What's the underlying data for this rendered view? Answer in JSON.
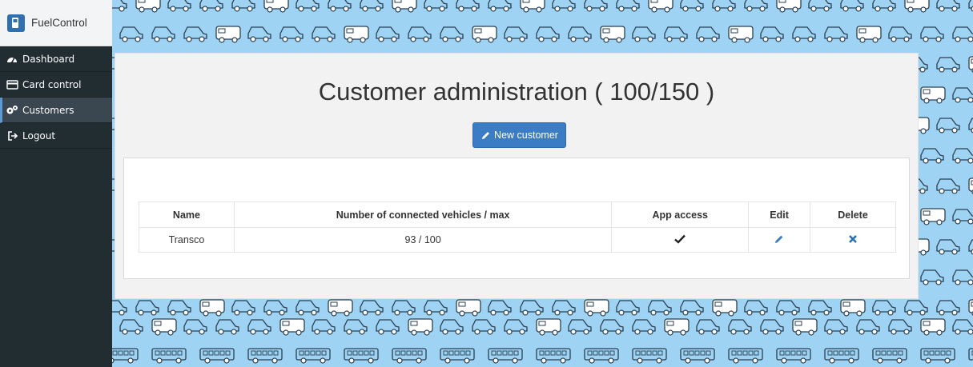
{
  "app": {
    "brand_name": "FuelControl",
    "brand_icon": "fuel-pump-icon"
  },
  "sidebar": {
    "items": [
      {
        "label": "Dashboard",
        "icon": "tachometer-icon",
        "active": false
      },
      {
        "label": "Card control",
        "icon": "credit-card-icon",
        "active": false
      },
      {
        "label": "Customers",
        "icon": "cogs-icon",
        "active": true
      },
      {
        "label": "Logout",
        "icon": "sign-out-icon",
        "active": false
      }
    ]
  },
  "main": {
    "title": "Customer administration ( 100/150 )",
    "new_button_label": "New customer",
    "table": {
      "headers": [
        "Name",
        "Number of connected vehicles / max",
        "App access",
        "Edit",
        "Delete"
      ],
      "rows": [
        {
          "name": "Transco",
          "vehicles": "93 / 100",
          "app_access": true
        }
      ]
    }
  },
  "colors": {
    "sidebar": "#222d32",
    "accent": "#3b7cc4",
    "background": "#9fd3f3",
    "edit_icon": "#3b7cc4",
    "delete_icon": "#2a6fb0"
  }
}
